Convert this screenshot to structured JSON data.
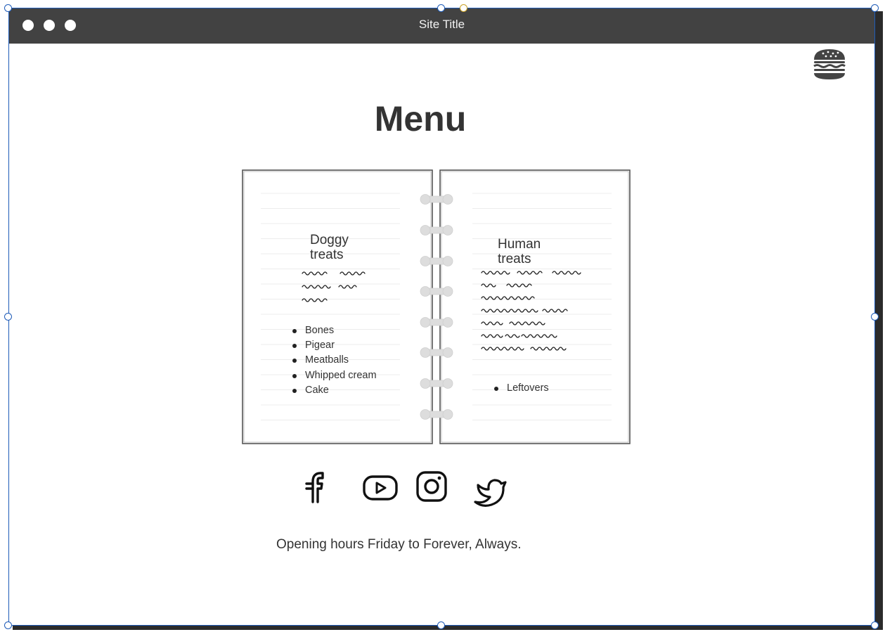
{
  "window": {
    "title": "Site Title"
  },
  "header": {
    "menu_icon": "hamburger-icon"
  },
  "main": {
    "heading": "Menu",
    "left_page": {
      "title_line1": "Doggy",
      "title_line2": "treats",
      "items": [
        "Bones",
        "Pigear",
        "Meatballs",
        "Whipped cream",
        "Cake"
      ]
    },
    "right_page": {
      "title_line1": "Human",
      "title_line2": "treats",
      "items": [
        "Leftovers"
      ]
    }
  },
  "social": {
    "icons": [
      "facebook-icon",
      "youtube-icon",
      "instagram-icon",
      "twitter-icon"
    ]
  },
  "footer": {
    "text": "Opening hours Friday to Forever, Always."
  },
  "colors": {
    "titlebar": "#424242",
    "selection": "#1e5bb8",
    "text": "#333333"
  }
}
